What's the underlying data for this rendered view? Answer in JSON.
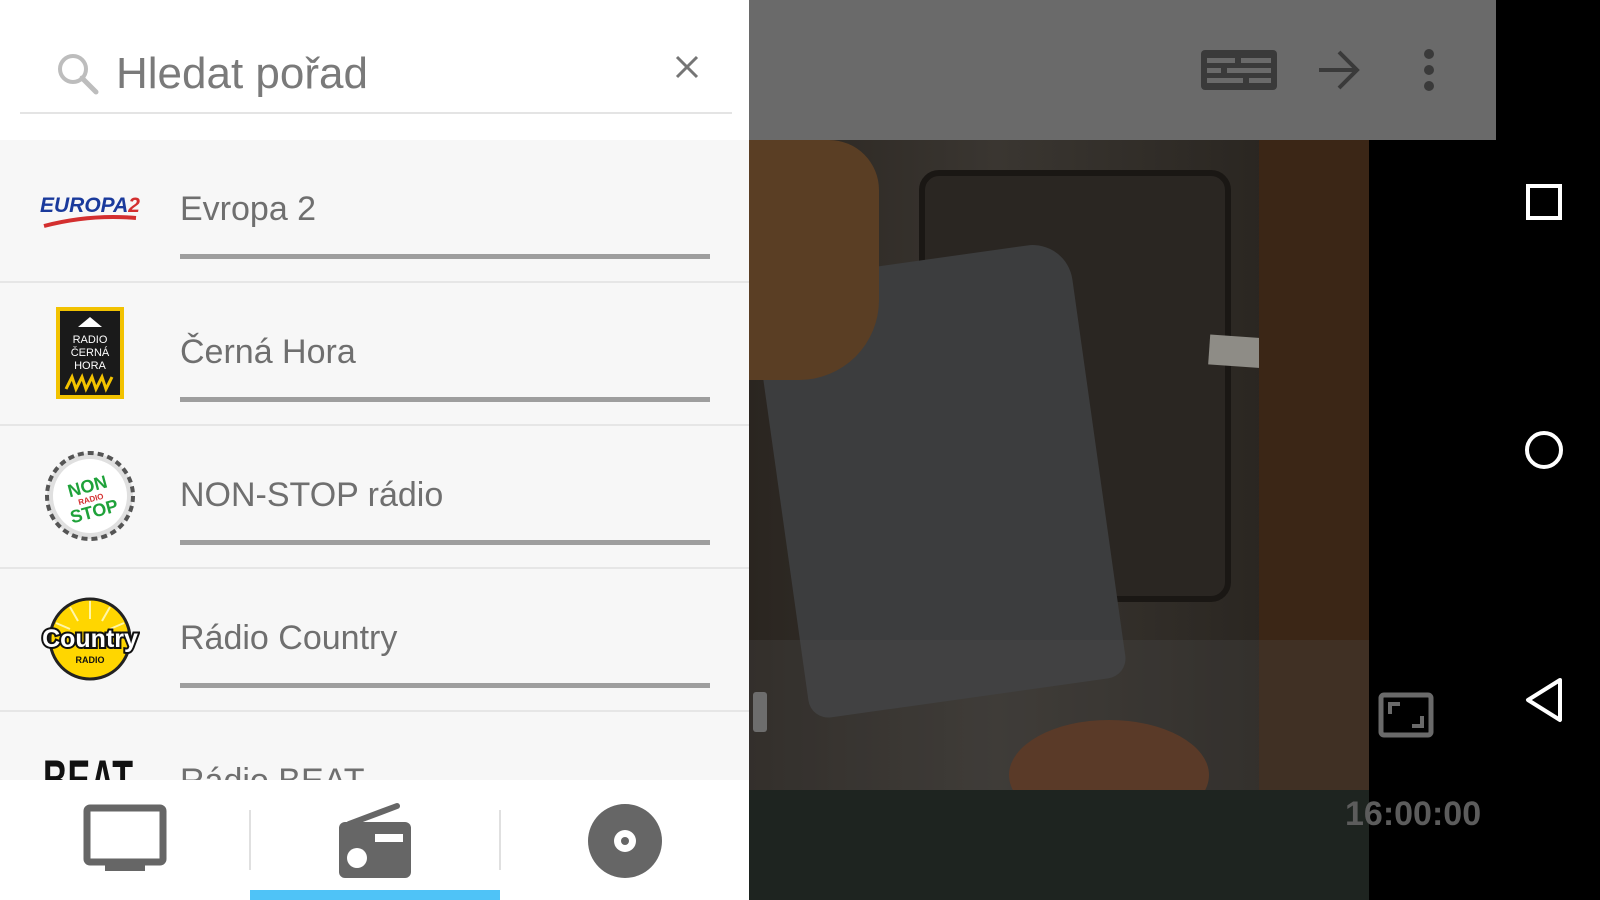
{
  "search": {
    "placeholder": "Hledat pořad",
    "icon": "search-icon",
    "clear_icon": "close-icon"
  },
  "stations": [
    {
      "name": "Evropa 2",
      "logo": "europa2-logo",
      "logo_text": "EUROPA 2"
    },
    {
      "name": "Černá Hora",
      "logo": "radio-cerna-hora-logo",
      "logo_text": "RADIO ČERNÁ HORA"
    },
    {
      "name": "NON-STOP rádio",
      "logo": "nonstop-radio-logo",
      "logo_text": "NON RADIO STOP"
    },
    {
      "name": "Rádio Country",
      "logo": "radio-country-logo",
      "logo_text": "Country RADIO"
    },
    {
      "name": "Rádio BEAT",
      "logo": "radio-beat-logo",
      "logo_text": "BEAT"
    }
  ],
  "bottom_tabs": [
    {
      "id": "tv",
      "icon": "tv-icon",
      "selected": false
    },
    {
      "id": "radio",
      "icon": "radio-icon",
      "selected": true
    },
    {
      "id": "disc",
      "icon": "disc-icon",
      "selected": false
    }
  ],
  "player": {
    "time": "16:00:00",
    "toolbar_icons": [
      "program-guide-icon",
      "arrow-forward-icon",
      "more-vert-icon"
    ],
    "fullscreen_icon": "fullscreen-icon"
  },
  "system_nav": [
    "recents-icon",
    "home-icon",
    "back-icon"
  ],
  "colors": {
    "accent": "#4fc3f7",
    "drawer_bg": "#f7f7f7",
    "toolbar_bg": "#6a6a6a",
    "text": "#6f6f6f"
  }
}
